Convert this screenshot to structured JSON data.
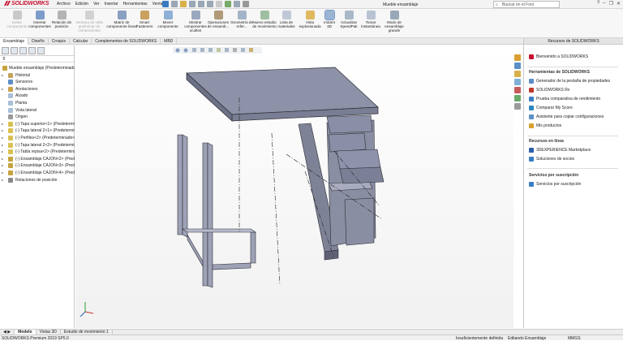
{
  "app": {
    "logo": "SOLIDWORKS",
    "document_title": "Mueble ensamblaje"
  },
  "menu": [
    "Archivo",
    "Edición",
    "Ver",
    "Insertar",
    "Herramientas",
    "Ventana"
  ],
  "search": {
    "placeholder": "Buscar en el Foro"
  },
  "ribbon": [
    {
      "label": "Editar componente",
      "icon": "edit-component-icon",
      "color": "#c9c9c9",
      "disabled": true
    },
    {
      "label": "Insertar componentes",
      "icon": "insert-components-icon",
      "color": "#7d9cc9",
      "disabled": false
    },
    {
      "label": "Relación de posición",
      "icon": "mate-icon",
      "color": "#b4b4b4",
      "disabled": false
    },
    {
      "label": "Ventana de vista preliminar de componentes",
      "icon": "preview-window-icon",
      "color": "#d2d2d2",
      "disabled": true
    },
    {
      "label": "Matriz de componente lineal",
      "icon": "linear-pattern-icon",
      "color": "#8aa0c0",
      "disabled": false
    },
    {
      "label": "Smart Fasteners",
      "icon": "smart-fasteners-icon",
      "color": "#c8a060",
      "disabled": false
    },
    {
      "label": "Mover componente",
      "icon": "move-component-icon",
      "color": "#8fb0d6",
      "disabled": false
    },
    {
      "label": "Mostrar componentes ocultos",
      "icon": "show-hidden-icon",
      "color": "#9aa9bf",
      "disabled": false
    },
    {
      "label": "Operaciones de ensamb...",
      "icon": "assembly-features-icon",
      "color": "#b09a78",
      "disabled": false
    },
    {
      "label": "Geometría de refer...",
      "icon": "reference-geometry-icon",
      "color": "#a4b4c8",
      "disabled": false
    },
    {
      "label": "Nuevo estudio de movimiento",
      "icon": "motion-study-icon",
      "color": "#9ec0a0",
      "disabled": false
    },
    {
      "label": "Lista de materiales",
      "icon": "bom-icon",
      "color": "#c0c8d8",
      "disabled": false
    },
    {
      "label": "Vista explosionada",
      "icon": "exploded-view-icon",
      "color": "#e0b860",
      "disabled": false
    },
    {
      "label": "Instant 3D",
      "icon": "instant3d-icon",
      "color": "#9bb4d3",
      "disabled": false,
      "selected": true
    },
    {
      "label": "Actualizar SpeedPak",
      "icon": "speedpak-icon",
      "color": "#a8b8c8",
      "disabled": false
    },
    {
      "label": "Tomar instantánea",
      "icon": "snapshot-icon",
      "color": "#b8c4d4",
      "disabled": false
    },
    {
      "label": "Modo de ensamblaje grande",
      "icon": "large-assembly-icon",
      "color": "#98a8b8",
      "disabled": false
    }
  ],
  "tabs": [
    "Ensamblaje",
    "Diseño",
    "Croquis",
    "Calcular",
    "Complementos de SOLIDWORKS",
    "MBD"
  ],
  "tree": {
    "filter_icon": "filter-icon",
    "root": "Mueble ensamblaje  (Predeterminado",
    "items": [
      {
        "label": "Historial",
        "icon": "history-icon",
        "color": "#c4a45a",
        "expander": true
      },
      {
        "label": "Sensores",
        "icon": "sensor-icon",
        "color": "#5d8fc7",
        "expander": false
      },
      {
        "label": "Anotaciones",
        "icon": "annotations-icon",
        "color": "#c9a24a",
        "expander": true
      },
      {
        "label": "Alzado",
        "icon": "plane-icon",
        "color": "#a9bfd8",
        "expander": false
      },
      {
        "label": "Planta",
        "icon": "plane-icon",
        "color": "#a9bfd8",
        "expander": false
      },
      {
        "label": "Vista lateral",
        "icon": "plane-icon",
        "color": "#a9bfd8",
        "expander": false
      },
      {
        "label": "Origen",
        "icon": "origin-icon",
        "color": "#9a9a9a",
        "expander": false
      },
      {
        "label": "(-) Tapa superior<1> (Predetermina",
        "icon": "part-icon",
        "color": "#d9c050",
        "expander": true
      },
      {
        "label": "(-) Tapa lateral  2<1> (Predetermina",
        "icon": "part-icon",
        "color": "#d9c050",
        "expander": true
      },
      {
        "label": "(-) Perfiles<2> (Predeterminado<",
        "icon": "part-icon",
        "color": "#d9c050",
        "expander": true
      },
      {
        "label": "(-) Tapa lateral  2<2> (Predetermina",
        "icon": "part-icon",
        "color": "#d9c050",
        "expander": true
      },
      {
        "label": "(-) Tabla repisa<2> (Predetermina",
        "icon": "part-icon",
        "color": "#d9c050",
        "expander": true
      },
      {
        "label": "(-) Ensamblaje CAJON<2> (Predet",
        "icon": "subassembly-icon",
        "color": "#c5a33d",
        "expander": true
      },
      {
        "label": "(-) Ensamblaje CAJON<3> (Prede",
        "icon": "subassembly-icon",
        "color": "#c5a33d",
        "expander": true
      },
      {
        "label": "(-) Ensamblaje CAJON<4> (Prede",
        "icon": "subassembly-icon",
        "color": "#c5a33d",
        "expander": true
      },
      {
        "label": "Relaciones de posición",
        "icon": "mates-icon",
        "color": "#8a8a8a",
        "expander": true
      }
    ]
  },
  "resources": {
    "title": "Recursos de SOLIDWORKS",
    "welcome": "Bienvenido a SOLIDWORKS",
    "tools_title": "Herramientas de SOLIDWORKS",
    "tools": [
      {
        "label": "Generador de la pestaña de propiedades",
        "icon": "property-tab-icon",
        "color": "#5d8fc7"
      },
      {
        "label": "SOLIDWORKS Rx",
        "icon": "rx-icon",
        "color": "#c0392b"
      },
      {
        "label": "Prueba comparativa de rendimiento",
        "icon": "benchmark-icon",
        "color": "#3b7dc4"
      },
      {
        "label": "Comparar My Score",
        "icon": "score-icon",
        "color": "#2e86c1"
      },
      {
        "label": "Asistente para copiar configuraciones",
        "icon": "copy-settings-icon",
        "color": "#5d8fc7"
      },
      {
        "label": "Mis productos",
        "icon": "products-icon",
        "color": "#d9a030"
      }
    ],
    "online_title": "Recursos en línea",
    "online": [
      {
        "label": "3DEXPERIENCE Marketplace",
        "icon": "marketplace-icon",
        "color": "#2a5fa8"
      },
      {
        "label": "Soluciones de socios",
        "icon": "partners-icon",
        "color": "#3b7dc4"
      }
    ],
    "subs_title": "Servicios por suscripción",
    "subs": [
      {
        "label": "Servicios por suscripción",
        "icon": "subscription-icon",
        "color": "#3b7dc4"
      }
    ]
  },
  "bottom_tabs": [
    "Modelo",
    "Vistas 3D",
    "Estudio de movimiento 1"
  ],
  "status": {
    "version": "SOLIDWORKS Premium 2019 SP5.0",
    "definition": "Insuficientemente definida",
    "mode": "Editando Ensamblaje",
    "units": "MMGS"
  }
}
